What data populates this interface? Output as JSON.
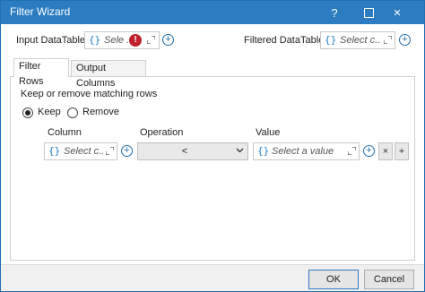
{
  "window": {
    "title": "Filter Wizard"
  },
  "title_buttons": {
    "help": "?",
    "close": "✕"
  },
  "input_datatable": {
    "label": "Input DataTable",
    "value": "Sele ...",
    "error_glyph": "!"
  },
  "filtered_datatable": {
    "label": "Filtered DataTable",
    "value": "Select c..."
  },
  "tabs": [
    {
      "label": "Filter Rows",
      "active": true
    },
    {
      "label": "Output Columns",
      "active": false
    }
  ],
  "filter_rows": {
    "heading": "Keep or remove matching rows",
    "keep_label": "Keep",
    "remove_label": "Remove",
    "selected": "Keep",
    "columns": {
      "column": "Column",
      "operation": "Operation",
      "value": "Value"
    },
    "row": {
      "column_placeholder": "Select c...",
      "operation": "<",
      "value_placeholder": "Select a value",
      "remove_glyph": "×",
      "add_glyph": "+"
    }
  },
  "footer": {
    "ok": "OK",
    "cancel": "Cancel"
  },
  "colors": {
    "titlebar": "#2b7cc1",
    "brace": "#1e7fc4",
    "error": "#c0202a"
  },
  "icons": [
    "help-icon",
    "maximize-icon",
    "close-icon",
    "brace-icon",
    "expand-icon",
    "error-icon",
    "plus-circle-icon"
  ]
}
